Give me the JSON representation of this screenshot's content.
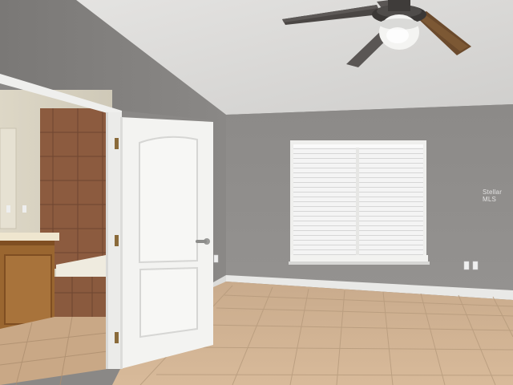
{
  "watermark": {
    "text": "Stellar MLS"
  },
  "colors": {
    "ceiling": "#d9d8d6",
    "back_wall": "#8e8c8a",
    "left_wall": "#7f7d7b",
    "floor_tile": "#d4b595",
    "grout": "#b89b7c",
    "door": "#f2f2f0",
    "trim": "#ececea",
    "bath_tile": "#8a5a3e",
    "vanity_wood": "#9a6630"
  },
  "icons": [
    "ceiling-fan-icon",
    "door-handle-icon",
    "outlet-icon"
  ]
}
